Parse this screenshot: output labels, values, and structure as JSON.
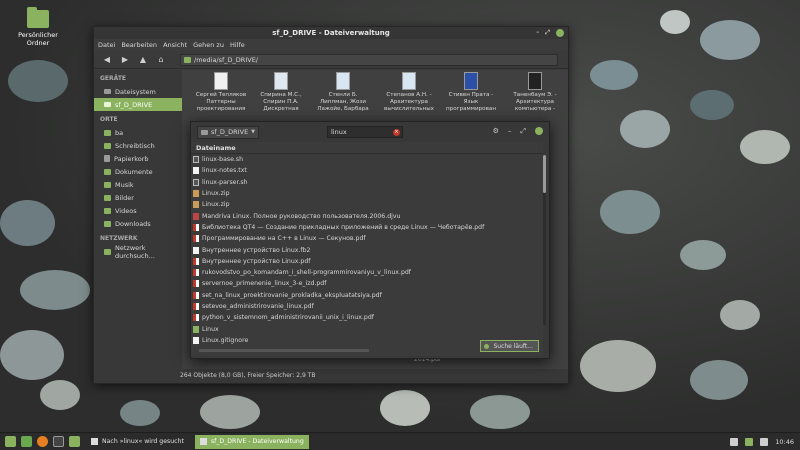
{
  "desktop": {
    "icon_label": "Persönlicher Ordner"
  },
  "window": {
    "title": "sf_D_DRIVE - Dateiverwaltung",
    "menu": [
      "Datei",
      "Bearbeiten",
      "Ansicht",
      "Gehen zu",
      "Hilfe"
    ],
    "path": "/media/sf_D_DRIVE/",
    "status": "264 Objekte (8,0 GB), Freier Speicher: 2,9 TB"
  },
  "sidebar": {
    "sections": [
      {
        "heading": "GERÄTE",
        "items": [
          {
            "label": "Dateisystem",
            "icon": "drive-icon"
          },
          {
            "label": "sf_D_DRIVE",
            "icon": "drive-icon",
            "active": true
          }
        ]
      },
      {
        "heading": "ORTE",
        "items": [
          {
            "label": "ba",
            "icon": "home-icon"
          },
          {
            "label": "Schreibtisch",
            "icon": "folder-icon"
          },
          {
            "label": "Papierkorb",
            "icon": "trash-icon"
          },
          {
            "label": "Dokumente",
            "icon": "folder-icon"
          },
          {
            "label": "Musik",
            "icon": "folder-icon"
          },
          {
            "label": "Bilder",
            "icon": "folder-icon"
          },
          {
            "label": "Videos",
            "icon": "folder-icon"
          },
          {
            "label": "Downloads",
            "icon": "folder-icon"
          }
        ]
      },
      {
        "heading": "NETZWERK",
        "items": [
          {
            "label": "Netzwerk durchsuch...",
            "icon": "network-icon"
          }
        ]
      }
    ]
  },
  "content": {
    "top_files": [
      {
        "line1": "Сергей Тепляков",
        "line2": "Паттерны",
        "line3": "проектирования"
      },
      {
        "line1": "Спирина М.С.,",
        "line2": "Спирин П.А.",
        "line3": "Дискретная"
      },
      {
        "line1": "Стенли Б.",
        "line2": "Липпман, Жози",
        "line3": "Лажойе, Барбара"
      },
      {
        "line1": "Степанов А.Н. -",
        "line2": "Архитектура",
        "line3": "вычислительных"
      },
      {
        "line1": "Стивен Прата -",
        "line2": "Язык",
        "line3": "программирован"
      },
      {
        "line1": "Таненбаум Э. -",
        "line2": "Архитектура",
        "line3": "компьютера -"
      }
    ],
    "bottom_label": "2014.pdf"
  },
  "search": {
    "location": "sf_D_DRIVE",
    "query": "linux",
    "column_header": "Dateiname",
    "stop_button": "Suche läuft...",
    "results": [
      {
        "name": "linux-base.sh",
        "type": "sh"
      },
      {
        "name": "linux-notes.txt",
        "type": "txt"
      },
      {
        "name": "linux-parser.sh",
        "type": "sh"
      },
      {
        "name": "Linux.zip",
        "type": "zip"
      },
      {
        "name": "Linux.zip",
        "type": "zip"
      },
      {
        "name": "Mandriva Linux. Полное руководство пользователя.2006.djvu",
        "type": "djvu"
      },
      {
        "name": "Библиотека QT4 — Создание прикладных приложений в среде Linux — Чеботарёв.pdf",
        "type": "pdf"
      },
      {
        "name": "Программирование на C++ в Linux — Секунов.pdf",
        "type": "pdf"
      },
      {
        "name": "Внутреннее устройство Linux.fb2",
        "type": "txt"
      },
      {
        "name": "Внутреннее устройство Linux.pdf",
        "type": "pdf"
      },
      {
        "name": "rukovodstvo_po_komandam_i_shell-programmirovaniyu_v_linux.pdf",
        "type": "pdf"
      },
      {
        "name": "servernoe_primenenie_linux_3-e_izd.pdf",
        "type": "pdf"
      },
      {
        "name": "set_na_linux_proektirovanie_prokladka_ekspluatatsiya.pdf",
        "type": "pdf"
      },
      {
        "name": "setevoe_administrirovanie_linux.pdf",
        "type": "pdf"
      },
      {
        "name": "python_v_sistemnom_administrirovanii_unix_i_linux.pdf",
        "type": "pdf"
      },
      {
        "name": "Linux",
        "type": "folder"
      },
      {
        "name": "Linux.gitignore",
        "type": "txt"
      }
    ]
  },
  "taskbar": {
    "tasks": [
      {
        "label": "Nach »linux« wird gesucht",
        "active": true
      },
      {
        "label": "sf_D_DRIVE - Dateiverwaltung",
        "active": false
      }
    ],
    "clock": "10:46"
  },
  "colors": {
    "accent": "#8bb35f",
    "window_bg": "#3c3c3c",
    "pdf_red": "#c0392b"
  }
}
